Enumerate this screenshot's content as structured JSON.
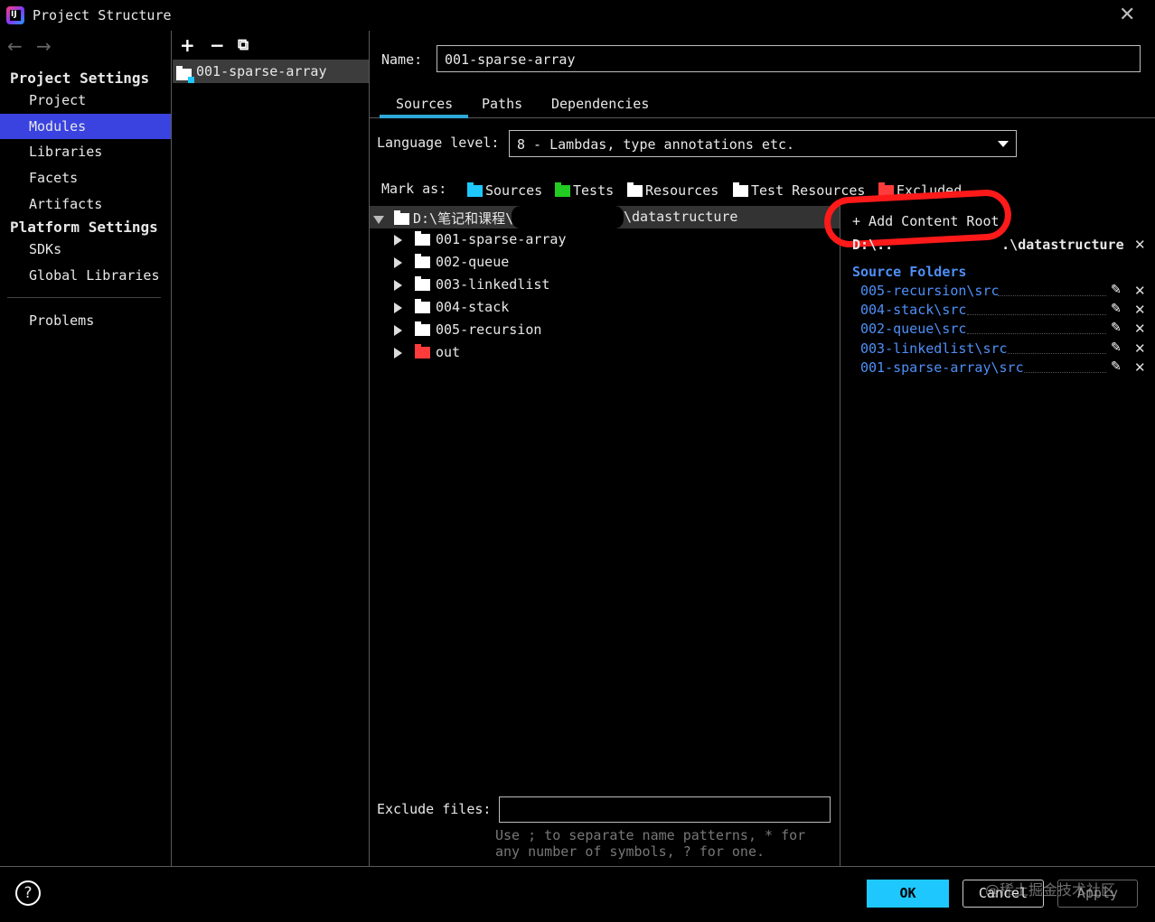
{
  "window": {
    "title": "Project Structure"
  },
  "nav": {
    "project_settings": "Project Settings",
    "project_items": [
      "Project",
      "Modules",
      "Libraries",
      "Facets",
      "Artifacts"
    ],
    "platform_settings": "Platform Settings",
    "platform_items": [
      "SDKs",
      "Global Libraries"
    ],
    "problems": "Problems",
    "selected": "Modules"
  },
  "modules": {
    "items": [
      "001-sparse-array"
    ]
  },
  "module": {
    "name_label": "Name:",
    "name_value": "001-sparse-array",
    "tabs": [
      "Sources",
      "Paths",
      "Dependencies"
    ],
    "active_tab": "Sources",
    "language_label": "Language level:",
    "language_value": "8 - Lambdas, type annotations etc.",
    "mark_as_label": "Mark as:",
    "mark_as": [
      {
        "label": "Sources",
        "color": "#1ec8ff"
      },
      {
        "label": "Tests",
        "color": "#22cc22"
      },
      {
        "label": "Resources",
        "color": "#ffffff"
      },
      {
        "label": "Test Resources",
        "color": "#ffffff"
      },
      {
        "label": "Excluded",
        "color": "#ff3b3b"
      }
    ]
  },
  "tree": {
    "root": "D:\\笔记和课程\\",
    "root_suffix": "\\datastructure",
    "children": [
      {
        "label": "001-sparse-array",
        "color": "#ffffff"
      },
      {
        "label": "002-queue",
        "color": "#ffffff"
      },
      {
        "label": "003-linkedlist",
        "color": "#ffffff"
      },
      {
        "label": "004-stack",
        "color": "#ffffff"
      },
      {
        "label": "005-recursion",
        "color": "#ffffff"
      },
      {
        "label": "out",
        "color": "#ff3b3b"
      }
    ]
  },
  "content_root": {
    "add_label": "+ Add Content Root",
    "path_prefix": "D:\\..",
    "path_suffix": ".\\datastructure",
    "source_folders_label": "Source Folders",
    "source_folders": [
      "005-recursion\\src",
      "004-stack\\src",
      "002-queue\\src",
      "003-linkedlist\\src",
      "001-sparse-array\\src"
    ]
  },
  "exclude": {
    "label": "Exclude files:",
    "value": "",
    "hint": "Use ; to separate name patterns, * for\nany number of symbols, ? for one."
  },
  "footer": {
    "help": "?",
    "ok": "OK",
    "cancel": "Cancel",
    "apply": "Apply",
    "watermark": "@稀土掘金技术社区"
  },
  "colors": {
    "accent": "#1ec8ff",
    "selection": "#3a43e0",
    "link": "#4f8ff7",
    "highlight_circle": "#ff1a1a"
  }
}
